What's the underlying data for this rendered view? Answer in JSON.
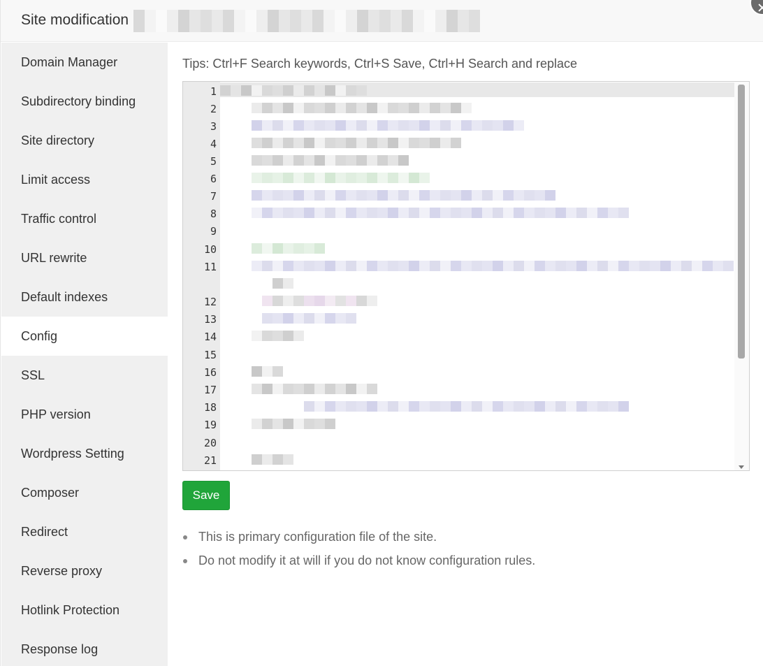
{
  "dialog": {
    "title": "Site modification",
    "close_icon": "close-icon"
  },
  "sidebar": {
    "items": [
      {
        "label": "Domain Manager",
        "active": false
      },
      {
        "label": "Subdirectory binding",
        "active": false
      },
      {
        "label": "Site directory",
        "active": false
      },
      {
        "label": "Limit access",
        "active": false
      },
      {
        "label": "Traffic control",
        "active": false
      },
      {
        "label": "URL rewrite",
        "active": false
      },
      {
        "label": "Default indexes",
        "active": false
      },
      {
        "label": "Config",
        "active": true
      },
      {
        "label": "SSL",
        "active": false
      },
      {
        "label": "PHP version",
        "active": false
      },
      {
        "label": "Wordpress Setting",
        "active": false
      },
      {
        "label": "Composer",
        "active": false
      },
      {
        "label": "Redirect",
        "active": false
      },
      {
        "label": "Reverse proxy",
        "active": false
      },
      {
        "label": "Hotlink Protection",
        "active": false
      },
      {
        "label": "Response log",
        "active": false
      }
    ]
  },
  "main": {
    "tips": "Tips: Ctrl+F Search keywords, Ctrl+S Save, Ctrl+H Search and replace",
    "editor": {
      "line_numbers": [
        "1",
        "2",
        "3",
        "4",
        "5",
        "6",
        "7",
        "8",
        "9",
        "10",
        "11",
        "12",
        "13",
        "14",
        "15",
        "16",
        "17",
        "18",
        "19",
        "20",
        "21"
      ],
      "active_line": "1"
    },
    "save_label": "Save",
    "notes": [
      "This is primary configuration file of the site.",
      "Do not modify it at will if you do not know configuration rules."
    ]
  },
  "colors": {
    "accent_green": "#20a53a",
    "sidebar_bg": "#f0f0f0",
    "gutter_bg": "#ebebeb"
  }
}
